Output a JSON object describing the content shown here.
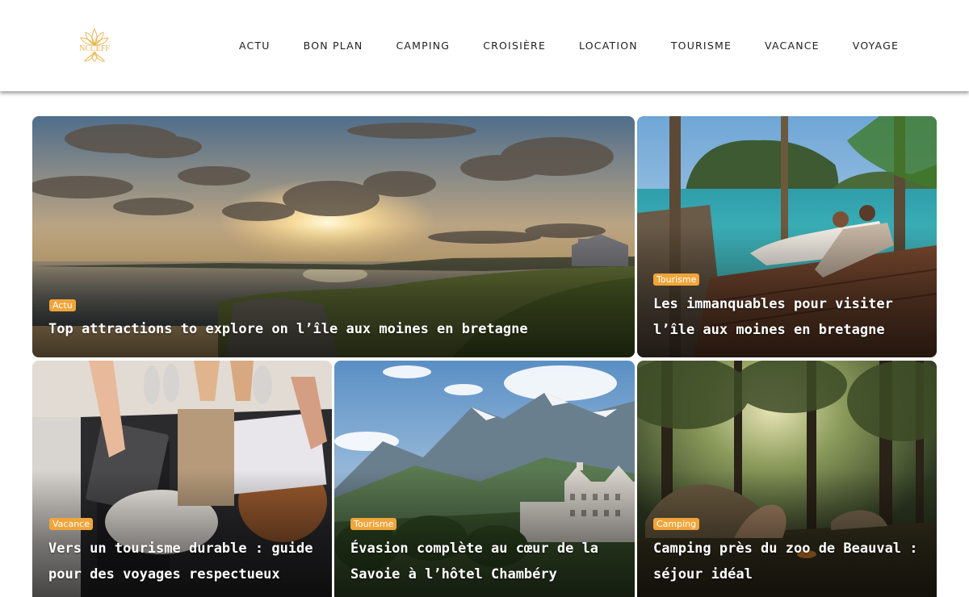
{
  "site": {
    "logo_text": "NCCEFF",
    "colors": {
      "accent": "#f0a53a",
      "logo_gold": "#e9b24a",
      "nav_text": "#222222"
    }
  },
  "nav": {
    "items": [
      {
        "label": "ACTU"
      },
      {
        "label": "BON PLAN"
      },
      {
        "label": "CAMPING"
      },
      {
        "label": "CROISIÈRE"
      },
      {
        "label": "LOCATION"
      },
      {
        "label": "TOURISME"
      },
      {
        "label": "VACANCE"
      },
      {
        "label": "VOYAGE"
      }
    ]
  },
  "articles": [
    {
      "category": "Actu",
      "title": "Top attractions to explore on l’île aux moines en bretagne",
      "image": "coastal sunset with castle"
    },
    {
      "category": "Tourisme",
      "title": "Les immanquables pour visiter l’île aux moines en bretagne",
      "image": "couple relaxing on deck by turquoise bay"
    },
    {
      "category": "Vacance",
      "title": "Vers un tourisme durable : guide pour des voyages respectueux",
      "image": "packing a suitcase"
    },
    {
      "category": "Tourisme",
      "title": "Évasion complète au cœur de la Savoie à l’hôtel Chambéry",
      "image": "alpine mountains and grand hotel"
    },
    {
      "category": "Camping",
      "title": "Camping près du zoo de Beauval : séjour idéal",
      "image": "tents in a sunlit forest"
    }
  ]
}
